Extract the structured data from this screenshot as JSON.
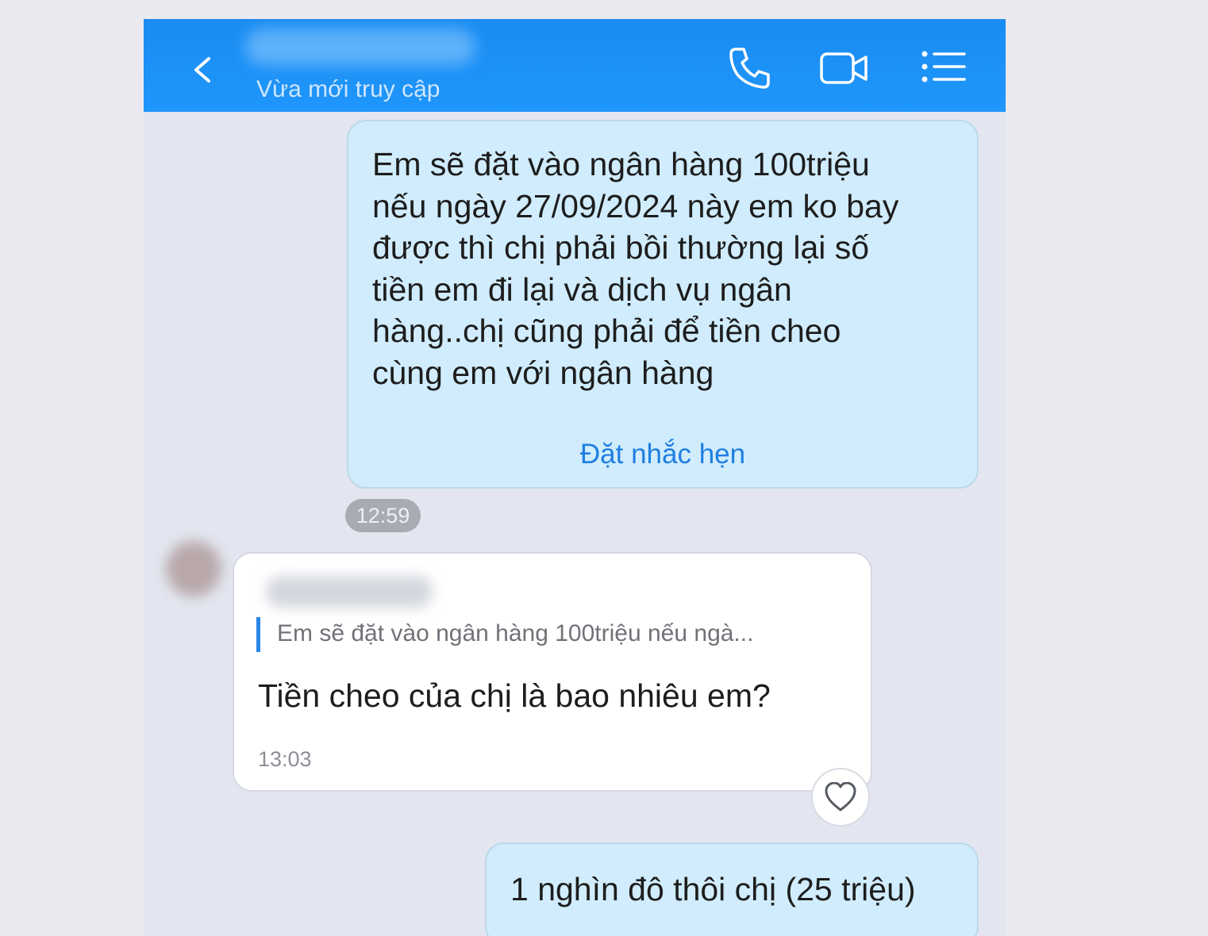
{
  "header": {
    "status": "Vừa mới truy cập",
    "accent": "#1f96fb",
    "icons": [
      "back-icon",
      "phone-icon",
      "video-icon",
      "list-menu-icon"
    ]
  },
  "messages": {
    "outgoing_1": {
      "text": "Em sẽ đặt vào ngân hàng 100triệu\nnếu ngày 27/09/2024 này em ko bay\nđược thì chị phải bồi thường lại số\ntiền em đi lại và dịch vụ ngân\nhàng..chị cũng phải để tiền cheo\ncùng em với ngân hàng",
      "action": "Đặt nhắc hẹn",
      "time": "12:59"
    },
    "incoming_1": {
      "quoted": "Em sẽ đặt vào ngân hàng 100triệu nếu ngà...",
      "text": "Tiền cheo của chị là bao nhiêu em?",
      "time": "13:03"
    },
    "outgoing_2": {
      "text": "1 nghìn đô thôi chị (25 triệu)"
    }
  },
  "colors": {
    "outgoing_bubble": "#d0ecfd",
    "incoming_bubble": "#ffffff",
    "link": "#1f7fe0"
  }
}
